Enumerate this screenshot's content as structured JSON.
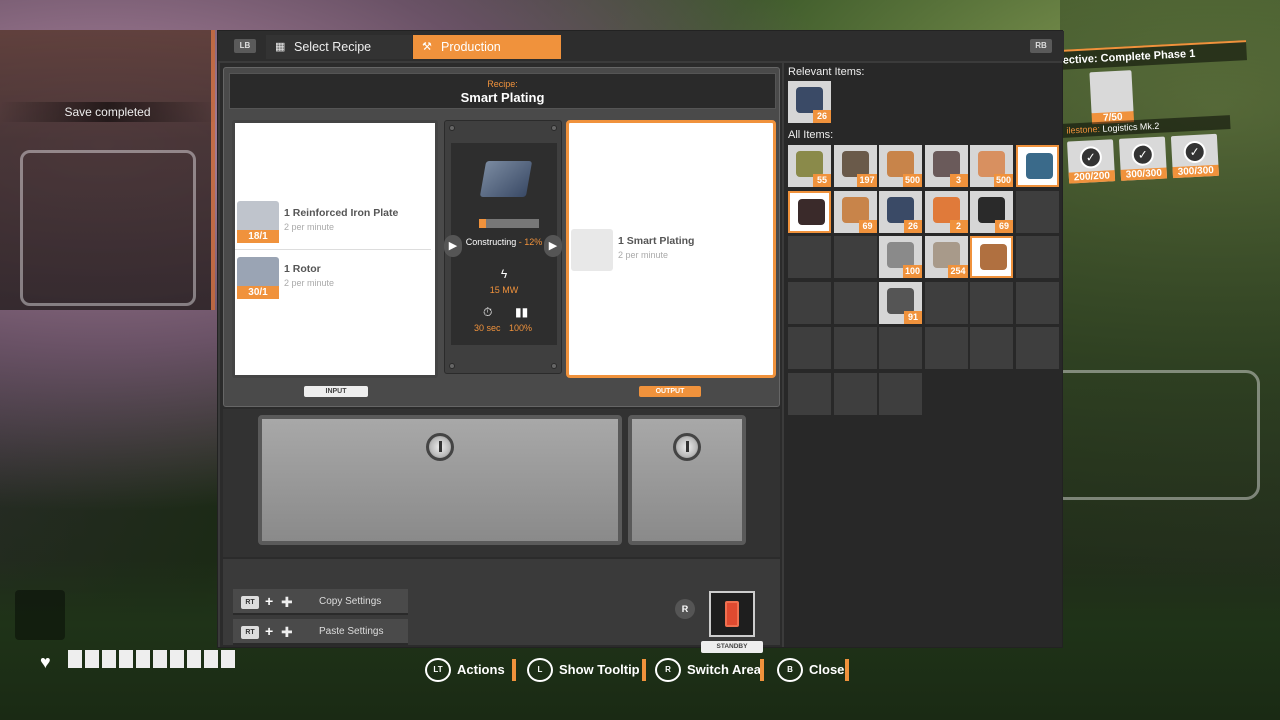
{
  "world": {
    "save_toast": "Save completed"
  },
  "objective": {
    "prefix": "ective:",
    "title": "Complete Phase 1",
    "item_count": "7/50",
    "milestone_prefix": "ilestone:",
    "milestone_name": "Logistics Mk.2",
    "milestone_items": [
      "200/200",
      "300/300",
      "300/300"
    ]
  },
  "tabs": {
    "lb": "LB",
    "rb": "RB",
    "select_recipe": "Select Recipe",
    "production": "Production"
  },
  "recipe": {
    "label": "Recipe:",
    "name": "Smart Plating"
  },
  "inputs": [
    {
      "name": "1 Reinforced Iron Plate",
      "rate": "2 per minute",
      "count": "18/1"
    },
    {
      "name": "1 Rotor",
      "rate": "2 per minute",
      "count": "30/1"
    }
  ],
  "output": {
    "name": "1 Smart Plating",
    "rate": "2 per minute"
  },
  "machine": {
    "status": "Constructing",
    "progress_label": "12%",
    "progress": 0.12,
    "power": "15 MW",
    "cycle_time": "30 sec",
    "clock_speed": "100%"
  },
  "tags": {
    "input": "INPUT",
    "output": "OUTPUT",
    "standby": "STANDBY"
  },
  "settings": {
    "rt": "RT",
    "copy": "Copy Settings",
    "paste": "Paste Settings",
    "standby_key": "R"
  },
  "inventory": {
    "relevant_label": "Relevant Items:",
    "all_label": "All Items:",
    "relevant_items": [
      {
        "count": "26",
        "color": "#3a4a66"
      }
    ],
    "grid": [
      {
        "count": "55",
        "color": "#8a8a4a"
      },
      {
        "count": "197",
        "color": "#6a5a4a"
      },
      {
        "count": "500",
        "color": "#c8844a"
      },
      {
        "count": "3",
        "color": "#6a5a5a"
      },
      {
        "count": "500",
        "color": "#d89060"
      },
      {
        "count": "",
        "color": "#3a6a8a",
        "hl": true
      },
      {
        "count": "",
        "color": "#3a2a2a",
        "hl": true
      },
      {
        "count": "69",
        "color": "#c8844a"
      },
      {
        "count": "26",
        "color": "#3a4a66"
      },
      {
        "count": "2",
        "color": "#e07a3a"
      },
      {
        "count": "69",
        "color": "#2a2a2a"
      },
      {
        "count": null
      },
      {
        "count": null
      },
      {
        "count": null
      },
      {
        "count": "100",
        "color": "#8a8a8a"
      },
      {
        "count": "254",
        "color": "#a89a8a"
      },
      {
        "count": "",
        "color": "#b07040",
        "hl": true
      },
      {
        "count": null
      },
      {
        "count": null
      },
      {
        "count": null
      },
      {
        "count": "91",
        "color": "#555555"
      },
      {
        "count": null
      },
      {
        "count": null
      },
      {
        "count": null
      },
      {
        "count": null
      },
      {
        "count": null
      },
      {
        "count": null
      },
      {
        "count": null
      },
      {
        "count": null
      },
      {
        "count": null
      },
      {
        "count": null
      },
      {
        "count": null
      },
      {
        "count": null
      }
    ]
  },
  "footer": {
    "actions_key": "LT",
    "actions": "Actions",
    "tooltip_key": "L",
    "tooltip": "Show Tooltip",
    "switch_key": "R",
    "switch": "Switch Area",
    "close_key": "B",
    "close": "Close"
  },
  "colors": {
    "accent": "#f0923c",
    "panel": "#3b3b3b"
  }
}
